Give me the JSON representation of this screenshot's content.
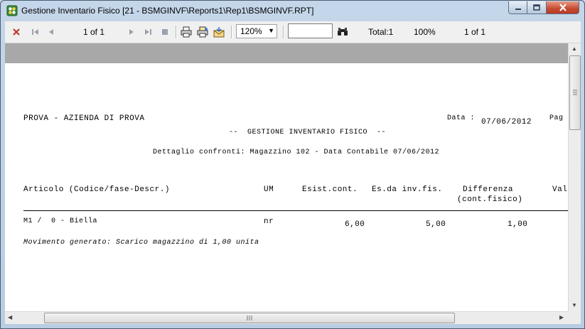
{
  "window": {
    "title": "Gestione Inventario Fisico [21 - BSMGINVF\\Reports1\\Rep1\\BSMGINVF.RPT]"
  },
  "toolbar": {
    "page_of": "1 of 1",
    "zoom": "120%",
    "total": "Total:1",
    "percent": "100%",
    "page_of_right": "1 of 1",
    "search_value": ""
  },
  "report": {
    "company": "PROVA - AZIENDA DI PROVA",
    "date_label": "Data :",
    "date_value": "07/06/2012",
    "page_label": "Pag",
    "title": "--  GESTIONE INVENTARIO FISICO  --",
    "subtitle": "Dettaglio confronti: Magazzino 102 - Data Contabile 07/06/2012",
    "columns": {
      "article": "Articolo (Codice/fase-Descr.)",
      "um": "UM",
      "esist": "Esist.cont.",
      "esda": "Es.da inv.fis.",
      "diff": "Differenza",
      "diff_sub": "(cont.fisico)",
      "val": "Val"
    },
    "row": {
      "article": "M1 /  0 - Biella",
      "um": "nr",
      "esist": "6,00",
      "esda": "5,00",
      "diff": "1,00"
    },
    "note": "Movimento generato: Scarico magazzino di 1,00 unita"
  },
  "icons": {
    "close": "close-icon",
    "first": "first-page-icon",
    "prev": "prev-page-icon",
    "next": "next-page-icon",
    "last": "last-page-icon",
    "stop": "stop-icon",
    "print": "print-icon",
    "print_setup": "print-setup-icon",
    "export": "export-icon",
    "search": "binoculars-icon"
  },
  "colors": {
    "close_red": "#c0392b",
    "title_bg": "#c4d6e9",
    "preview_gray": "#a8a8a8"
  }
}
